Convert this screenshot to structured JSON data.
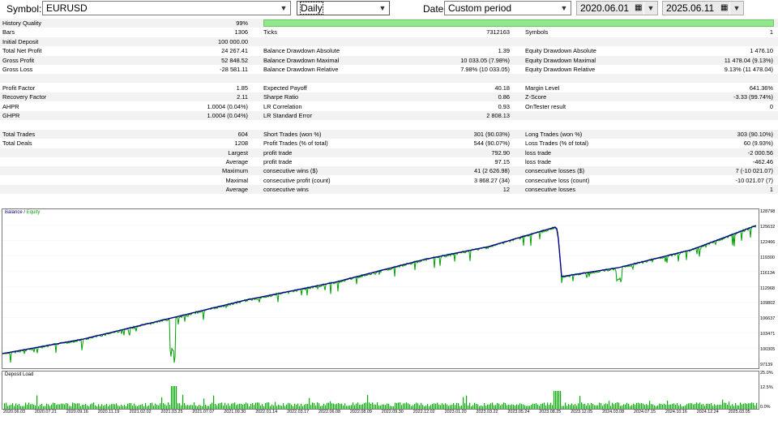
{
  "toolbar": {
    "symbol_label": "Symbol:",
    "symbol_value": "EURUSD",
    "period_value": "Daily",
    "date_label": "Date:",
    "date_mode": "Custom period",
    "date_from": "2020.06.01",
    "date_to": "2025.06.11"
  },
  "stats": {
    "history_quality_label": "History Quality",
    "history_quality_value": "99%",
    "history_quality_fill": 0.99,
    "rows": [
      {
        "l1": "Bars",
        "v1": "1306",
        "l2": "Ticks",
        "v2": "7312163",
        "l3": "Symbols",
        "v3": "1"
      },
      {
        "l1": "Initial Deposit",
        "v1": "100 000.00",
        "l2": "",
        "v2": "",
        "l3": "",
        "v3": ""
      },
      {
        "l1": "Total Net Profit",
        "v1": "24 267.41",
        "l2": "Balance Drawdown Absolute",
        "v2": "1.39",
        "l3": "Equity Drawdown Absolute",
        "v3": "1 476.10"
      },
      {
        "l1": "Gross Profit",
        "v1": "52 848.52",
        "l2": "Balance Drawdown Maximal",
        "v2": "10 033.05 (7.98%)",
        "l3": "Equity Drawdown Maximal",
        "v3": "11 478.04 (9.13%)"
      },
      {
        "l1": "Gross Loss",
        "v1": "-28 581.11",
        "l2": "Balance Drawdown Relative",
        "v2": "7.98% (10 033.05)",
        "l3": "Equity Drawdown Relative",
        "v3": "9.13% (11 478.04)"
      },
      {
        "l1": "",
        "v1": "",
        "l2": "",
        "v2": "",
        "l3": "",
        "v3": ""
      },
      {
        "l1": "Profit Factor",
        "v1": "1.85",
        "l2": "Expected Payoff",
        "v2": "40.18",
        "l3": "Margin Level",
        "v3": "641.36%"
      },
      {
        "l1": "Recovery Factor",
        "v1": "2.11",
        "l2": "Sharpe Ratio",
        "v2": "0.86",
        "l3": "Z-Score",
        "v3": "-3.33 (99.74%)"
      },
      {
        "l1": "AHPR",
        "v1": "1.0004 (0.04%)",
        "l2": "LR Correlation",
        "v2": "0.93",
        "l3": "OnTester result",
        "v3": "0"
      },
      {
        "l1": "GHPR",
        "v1": "1.0004 (0.04%)",
        "l2": "LR Standard Error",
        "v2": "2 808.13",
        "l3": "",
        "v3": ""
      },
      {
        "l1": "",
        "v1": "",
        "l2": "",
        "v2": "",
        "l3": "",
        "v3": ""
      },
      {
        "l1": "Total Trades",
        "v1": "604",
        "l2": "Short Trades (won %)",
        "v2": "301 (90.03%)",
        "l3": "Long Trades (won %)",
        "v3": "303 (90.10%)"
      },
      {
        "l1": "Total Deals",
        "v1": "1208",
        "l2": "Profit Trades (% of total)",
        "v2": "544 (90.07%)",
        "l3": "Loss Trades (% of total)",
        "v3": "60 (9.93%)"
      },
      {
        "l1": "",
        "v1": "Largest",
        "l2": "profit trade",
        "v2": "792.90",
        "l3": "loss trade",
        "v3": "-2 000.56"
      },
      {
        "l1": "",
        "v1": "Average",
        "l2": "profit trade",
        "v2": "97.15",
        "l3": "loss trade",
        "v3": "-462.46"
      },
      {
        "l1": "",
        "v1": "Maximum",
        "l2": "consecutive wins ($)",
        "v2": "41 (2 626.98)",
        "l3": "consecutive losses ($)",
        "v3": "7 (-10 021.07)"
      },
      {
        "l1": "",
        "v1": "Maximal",
        "l2": "consecutive profit (count)",
        "v2": "3 868.27 (34)",
        "l3": "consecutive loss (count)",
        "v3": "-10 021.07 (7)"
      },
      {
        "l1": "",
        "v1": "Average",
        "l2": "consecutive wins",
        "v2": "12",
        "l3": "consecutive losses",
        "v3": "1"
      }
    ]
  },
  "chart": {
    "legend_balance": "Balance",
    "legend_sep": " / ",
    "legend_equity": "Equity",
    "balance_color": "#00008b",
    "equity_color": "#00a000",
    "load_title": "Deposit Load",
    "y_ticks": [
      "128798",
      "125632",
      "122466",
      "119300",
      "116134",
      "112968",
      "109802",
      "106637",
      "103471",
      "100305",
      "97139"
    ],
    "load_ticks": [
      "25.0%",
      "12.5%",
      "0.0%"
    ],
    "x_ticks": [
      "2020.06.03",
      "2020.07.21",
      "2020.09.16",
      "2020.11.19",
      "2021.02.02",
      "2021.03.25",
      "2021.07.07",
      "2021.09.30",
      "2022.01.14",
      "2022.03.17",
      "2022.06.08",
      "2022.08.09",
      "2022.09.30",
      "2022.12.02",
      "2023.01.20",
      "2023.03.22",
      "2023.05.24",
      "2023.08.25",
      "2023.12.05",
      "2024.03.08",
      "2024.07.15",
      "2024.10.16",
      "2024.12.24",
      "2025.03.05"
    ]
  }
}
